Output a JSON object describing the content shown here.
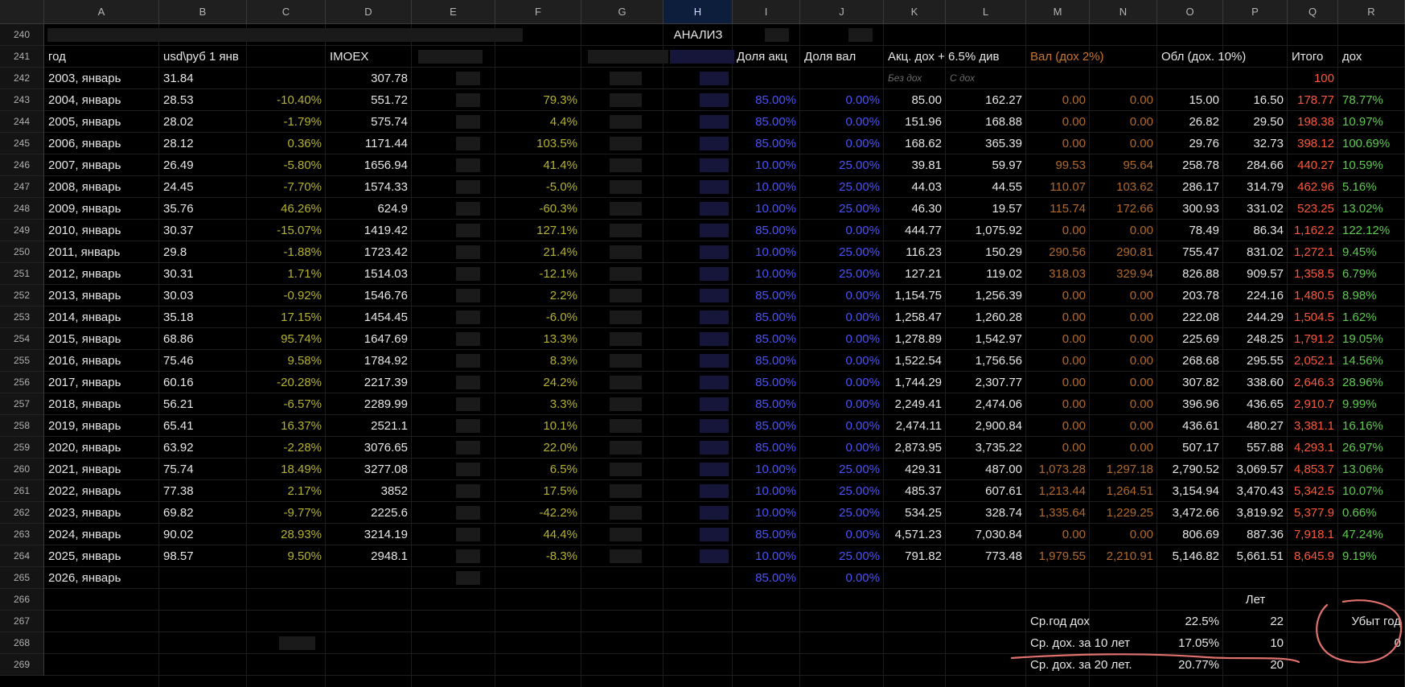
{
  "columns": [
    "A",
    "B",
    "C",
    "D",
    "E",
    "F",
    "G",
    "H",
    "I",
    "J",
    "K",
    "L",
    "M",
    "N",
    "O",
    "P",
    "Q",
    "R"
  ],
  "selected_column": "H",
  "row_numbers": [
    "240",
    "241",
    "242",
    "243",
    "244",
    "245",
    "246",
    "247",
    "248",
    "249",
    "250",
    "251",
    "252",
    "253",
    "254",
    "255",
    "256",
    "257",
    "258",
    "259",
    "260",
    "261",
    "262",
    "263",
    "264",
    "265",
    "266",
    "267",
    "268",
    "269"
  ],
  "title_row": {
    "analysis": "АНАЛИЗ"
  },
  "headers": {
    "year": "год",
    "usd": "usd\\руб 1 янв",
    "imoex": "IMOEX",
    "share_stocks": "Доля акц",
    "share_fx": "Доля вал",
    "stocks_income": "Акц. дох + 6.5% див",
    "fx_income": "Вал (дох 2%)",
    "bonds_income": "Обл (дох. 10%)",
    "total": "Итого",
    "yield": "дох"
  },
  "subheaders": {
    "without": "Без дох",
    "with": "С дох",
    "total_start": "100"
  },
  "rows": [
    {
      "year": "2003, январь",
      "usd": "31.84",
      "usd_chg": "",
      "imoex": "307.78",
      "imoex_chg": "",
      "i": "",
      "j": "",
      "k": "",
      "l": "",
      "m": "",
      "n": "",
      "o": "",
      "p": "",
      "q": "",
      "r": ""
    },
    {
      "year": "2004, январь",
      "usd": "28.53",
      "usd_chg": "-10.40%",
      "imoex": "551.72",
      "imoex_chg": "79.3%",
      "i": "85.00%",
      "j": "0.00%",
      "k": "85.00",
      "l": "162.27",
      "m": "0.00",
      "n": "0.00",
      "o": "15.00",
      "p": "16.50",
      "q": "178.77",
      "r": "78.77%"
    },
    {
      "year": "2005, январь",
      "usd": "28.02",
      "usd_chg": "-1.79%",
      "imoex": "575.74",
      "imoex_chg": "4.4%",
      "i": "85.00%",
      "j": "0.00%",
      "k": "151.96",
      "l": "168.88",
      "m": "0.00",
      "n": "0.00",
      "o": "26.82",
      "p": "29.50",
      "q": "198.38",
      "r": "10.97%"
    },
    {
      "year": "2006, январь",
      "usd": "28.12",
      "usd_chg": "0.36%",
      "imoex": "1171.44",
      "imoex_chg": "103.5%",
      "i": "85.00%",
      "j": "0.00%",
      "k": "168.62",
      "l": "365.39",
      "m": "0.00",
      "n": "0.00",
      "o": "29.76",
      "p": "32.73",
      "q": "398.12",
      "r": "100.69%"
    },
    {
      "year": "2007, январь",
      "usd": "26.49",
      "usd_chg": "-5.80%",
      "imoex": "1656.94",
      "imoex_chg": "41.4%",
      "i": "10.00%",
      "j": "25.00%",
      "k": "39.81",
      "l": "59.97",
      "m": "99.53",
      "n": "95.64",
      "o": "258.78",
      "p": "284.66",
      "q": "440.27",
      "r": "10.59%"
    },
    {
      "year": "2008, январь",
      "usd": "24.45",
      "usd_chg": "-7.70%",
      "imoex": "1574.33",
      "imoex_chg": "-5.0%",
      "i": "10.00%",
      "j": "25.00%",
      "k": "44.03",
      "l": "44.55",
      "m": "110.07",
      "n": "103.62",
      "o": "286.17",
      "p": "314.79",
      "q": "462.96",
      "r": "5.16%"
    },
    {
      "year": "2009, январь",
      "usd": "35.76",
      "usd_chg": "46.26%",
      "imoex": "624.9",
      "imoex_chg": "-60.3%",
      "i": "10.00%",
      "j": "25.00%",
      "k": "46.30",
      "l": "19.57",
      "m": "115.74",
      "n": "172.66",
      "o": "300.93",
      "p": "331.02",
      "q": "523.25",
      "r": "13.02%"
    },
    {
      "year": "2010, январь",
      "usd": "30.37",
      "usd_chg": "-15.07%",
      "imoex": "1419.42",
      "imoex_chg": "127.1%",
      "i": "85.00%",
      "j": "0.00%",
      "k": "444.77",
      "l": "1,075.92",
      "m": "0.00",
      "n": "0.00",
      "o": "78.49",
      "p": "86.34",
      "q": "1,162.2",
      "r": "122.12%"
    },
    {
      "year": "2011, январь",
      "usd": "29.8",
      "usd_chg": "-1.88%",
      "imoex": "1723.42",
      "imoex_chg": "21.4%",
      "i": "10.00%",
      "j": "25.00%",
      "k": "116.23",
      "l": "150.29",
      "m": "290.56",
      "n": "290.81",
      "o": "755.47",
      "p": "831.02",
      "q": "1,272.1",
      "r": "9.45%"
    },
    {
      "year": "2012, январь",
      "usd": "30.31",
      "usd_chg": "1.71%",
      "imoex": "1514.03",
      "imoex_chg": "-12.1%",
      "i": "10.00%",
      "j": "25.00%",
      "k": "127.21",
      "l": "119.02",
      "m": "318.03",
      "n": "329.94",
      "o": "826.88",
      "p": "909.57",
      "q": "1,358.5",
      "r": "6.79%"
    },
    {
      "year": "2013, январь",
      "usd": "30.03",
      "usd_chg": "-0.92%",
      "imoex": "1546.76",
      "imoex_chg": "2.2%",
      "i": "85.00%",
      "j": "0.00%",
      "k": "1,154.75",
      "l": "1,256.39",
      "m": "0.00",
      "n": "0.00",
      "o": "203.78",
      "p": "224.16",
      "q": "1,480.5",
      "r": "8.98%"
    },
    {
      "year": "2014, январь",
      "usd": "35.18",
      "usd_chg": "17.15%",
      "imoex": "1454.45",
      "imoex_chg": "-6.0%",
      "i": "85.00%",
      "j": "0.00%",
      "k": "1,258.47",
      "l": "1,260.28",
      "m": "0.00",
      "n": "0.00",
      "o": "222.08",
      "p": "244.29",
      "q": "1,504.5",
      "r": "1.62%"
    },
    {
      "year": "2015, январь",
      "usd": "68.86",
      "usd_chg": "95.74%",
      "imoex": "1647.69",
      "imoex_chg": "13.3%",
      "i": "85.00%",
      "j": "0.00%",
      "k": "1,278.89",
      "l": "1,542.97",
      "m": "0.00",
      "n": "0.00",
      "o": "225.69",
      "p": "248.25",
      "q": "1,791.2",
      "r": "19.05%"
    },
    {
      "year": "2016, январь",
      "usd": "75.46",
      "usd_chg": "9.58%",
      "imoex": "1784.92",
      "imoex_chg": "8.3%",
      "i": "85.00%",
      "j": "0.00%",
      "k": "1,522.54",
      "l": "1,756.56",
      "m": "0.00",
      "n": "0.00",
      "o": "268.68",
      "p": "295.55",
      "q": "2,052.1",
      "r": "14.56%"
    },
    {
      "year": "2017, январь",
      "usd": "60.16",
      "usd_chg": "-20.28%",
      "imoex": "2217.39",
      "imoex_chg": "24.2%",
      "i": "85.00%",
      "j": "0.00%",
      "k": "1,744.29",
      "l": "2,307.77",
      "m": "0.00",
      "n": "0.00",
      "o": "307.82",
      "p": "338.60",
      "q": "2,646.3",
      "r": "28.96%"
    },
    {
      "year": "2018, январь",
      "usd": "56.21",
      "usd_chg": "-6.57%",
      "imoex": "2289.99",
      "imoex_chg": "3.3%",
      "i": "85.00%",
      "j": "0.00%",
      "k": "2,249.41",
      "l": "2,474.06",
      "m": "0.00",
      "n": "0.00",
      "o": "396.96",
      "p": "436.65",
      "q": "2,910.7",
      "r": "9.99%"
    },
    {
      "year": "2019, январь",
      "usd": "65.41",
      "usd_chg": "16.37%",
      "imoex": "2521.1",
      "imoex_chg": "10.1%",
      "i": "85.00%",
      "j": "0.00%",
      "k": "2,474.11",
      "l": "2,900.84",
      "m": "0.00",
      "n": "0.00",
      "o": "436.61",
      "p": "480.27",
      "q": "3,381.1",
      "r": "16.16%"
    },
    {
      "year": "2020, январь",
      "usd": "63.92",
      "usd_chg": "-2.28%",
      "imoex": "3076.65",
      "imoex_chg": "22.0%",
      "i": "85.00%",
      "j": "0.00%",
      "k": "2,873.95",
      "l": "3,735.22",
      "m": "0.00",
      "n": "0.00",
      "o": "507.17",
      "p": "557.88",
      "q": "4,293.1",
      "r": "26.97%"
    },
    {
      "year": "2021, январь",
      "usd": "75.74",
      "usd_chg": "18.49%",
      "imoex": "3277.08",
      "imoex_chg": "6.5%",
      "i": "10.00%",
      "j": "25.00%",
      "k": "429.31",
      "l": "487.00",
      "m": "1,073.28",
      "n": "1,297.18",
      "o": "2,790.52",
      "p": "3,069.57",
      "q": "4,853.7",
      "r": "13.06%"
    },
    {
      "year": "2022, январь",
      "usd": "77.38",
      "usd_chg": "2.17%",
      "imoex": "3852",
      "imoex_chg": "17.5%",
      "i": "10.00%",
      "j": "25.00%",
      "k": "485.37",
      "l": "607.61",
      "m": "1,213.44",
      "n": "1,264.51",
      "o": "3,154.94",
      "p": "3,470.43",
      "q": "5,342.5",
      "r": "10.07%"
    },
    {
      "year": "2023, январь",
      "usd": "69.82",
      "usd_chg": "-9.77%",
      "imoex": "2225.6",
      "imoex_chg": "-42.2%",
      "i": "10.00%",
      "j": "25.00%",
      "k": "534.25",
      "l": "328.74",
      "m": "1,335.64",
      "n": "1,229.25",
      "o": "3,472.66",
      "p": "3,819.92",
      "q": "5,377.9",
      "r": "0.66%"
    },
    {
      "year": "2024, январь",
      "usd": "90.02",
      "usd_chg": "28.93%",
      "imoex": "3214.19",
      "imoex_chg": "44.4%",
      "i": "85.00%",
      "j": "0.00%",
      "k": "4,571.23",
      "l": "7,030.84",
      "m": "0.00",
      "n": "0.00",
      "o": "806.69",
      "p": "887.36",
      "q": "7,918.1",
      "r": "47.24%"
    },
    {
      "year": "2025, январь",
      "usd": "98.57",
      "usd_chg": "9.50%",
      "imoex": "2948.1",
      "imoex_chg": "-8.3%",
      "i": "10.00%",
      "j": "25.00%",
      "k": "791.82",
      "l": "773.48",
      "m": "1,979.55",
      "n": "2,210.91",
      "o": "5,146.82",
      "p": "5,661.51",
      "q": "8,645.9",
      "r": "9.19%"
    },
    {
      "year": "2026, январь",
      "usd": "",
      "usd_chg": "",
      "imoex": "",
      "imoex_chg": "",
      "i": "85.00%",
      "j": "0.00%",
      "k": "",
      "l": "",
      "m": "",
      "n": "",
      "o": "",
      "p": "",
      "q": "",
      "r": ""
    }
  ],
  "summary": {
    "years_label": "Лет",
    "avg_label": "Ср.год дох",
    "avg_value": "22.5%",
    "avg_years": "22",
    "loss_label": "Убыт год",
    "ten_label": "Ср. дох. за 10 лет",
    "ten_value": "17.05%",
    "ten_years": "10",
    "loss_value": "0",
    "twenty_label": "Ср. дох. за 20 лет.",
    "twenty_value": "20.77%",
    "twenty_years": "20"
  },
  "colors": {
    "background": "#000000",
    "header_bg": "#1f1f1f",
    "percent_yellow": "#b6b22e",
    "alloc_blue": "#4a52ff",
    "fx_orange": "#b06a2b",
    "total_red": "#ff5838",
    "yield_green": "#5ecb4f",
    "annotation": "#e0716d"
  }
}
